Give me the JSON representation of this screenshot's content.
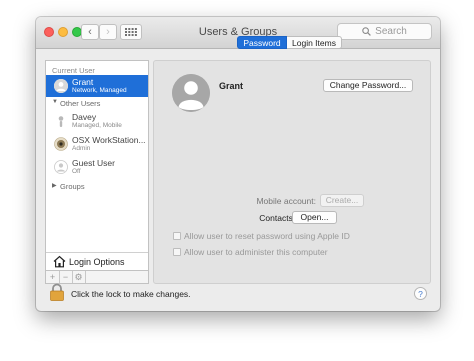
{
  "window": {
    "title": "Users & Groups"
  },
  "toolbar": {
    "search_placeholder": "Search"
  },
  "sidebar": {
    "current_user_heading": "Current User",
    "current_user": {
      "name": "Grant",
      "role": "Network, Managed"
    },
    "other_users_heading": "Other Users",
    "other_users": [
      {
        "name": "Davey",
        "role": "Managed, Mobile"
      },
      {
        "name": "OSX WorkStation...",
        "role": "Admin"
      },
      {
        "name": "Guest User",
        "role": "Off"
      }
    ],
    "groups_label": "Groups",
    "login_options_label": "Login Options",
    "add_symbol": "+",
    "remove_symbol": "−"
  },
  "tabs": [
    {
      "label": "Password",
      "active": true
    },
    {
      "label": "Login Items",
      "active": false
    }
  ],
  "detail": {
    "user_name": "Grant",
    "change_password_label": "Change Password...",
    "mobile_account_label": "Mobile account:",
    "create_label": "Create...",
    "contacts_card_label": "Contacts Card:",
    "open_label": "Open...",
    "checkbox_reset": "Allow user to reset password using Apple ID",
    "checkbox_admin": "Allow user to administer this computer"
  },
  "footer": {
    "lock_text": "Click the lock to make changes.",
    "help_symbol": "?"
  },
  "colors": {
    "accent": "#1f6fd8",
    "close": "#fc605c",
    "minimize": "#fdbc40",
    "zoom": "#34c84a"
  }
}
